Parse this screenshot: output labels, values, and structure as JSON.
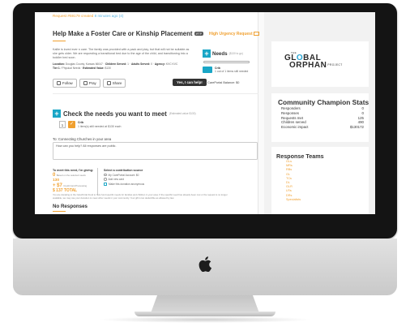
{
  "request": {
    "header": "Request #59179 created",
    "since": "8 minutes ago (4)",
    "title": "Help Make a Foster Care or Kinship Placement",
    "title_tag": "IFTP",
    "urgency": "High Urgency Request",
    "description": "Kallie is loved ever n care. The family was provided with a pack and play, but that will not be suitable as she gets older. We are requesting a transitional bed due to the age of the child, and transitioning into a toddler bed soon.",
    "meta": {
      "location_label": "Location:",
      "location": "Douglas County, Kansas 66047",
      "children_label": "Children Served:",
      "children": "1",
      "adults_label": "Adults Served:",
      "adults": "0",
      "agency_label": "Agency:",
      "agency": "KVC KVC",
      "tier_label": "Tier 1",
      "type": "Physical Needs",
      "est_label": "Estimated Value:",
      "est_value": "$130"
    },
    "buttons": {
      "follow": "Follow",
      "pray": "Pray",
      "share": "Share",
      "help": "Yes, I can help!"
    }
  },
  "needs": {
    "label": "Needs",
    "sub": "($130 to go)",
    "item_name": "Crib",
    "item_status": "1 out of 1 items still needed",
    "balance_label": "My CarePortal Balance:",
    "balance": "$0",
    "progress": 0
  },
  "check": {
    "label": "Check the needs you want to meet",
    "sub": "(Estimated value $130)",
    "qty": "1",
    "item_name": "Crib",
    "item_detail": "1 item(s) still needed at $130 each"
  },
  "churches": {
    "label": "To: Connecting Churches in your area",
    "placeholder": "How can you help? All responses are public."
  },
  "funding": {
    "meet_label": "To meet this need, I'm giving:",
    "amount1": "0",
    "amount1_note": "Based on the selected needs",
    "amount2": "130",
    "amount3": "+ $7",
    "amount3_note": "Credit Card Processing",
    "total": "$ 137 TOTAL",
    "source_label": "Select a contribution source",
    "opt1": "My CarePortal Account: $0",
    "opt2": "Add new card",
    "opt3": "Make this donation anonymous"
  },
  "fine_print": "You are donating to the CarePortal Fund to help fund specific needs for families and children in your area. If the specific need has already been met or the request is no longer available, we may use your donation to meet other needs in your community. Your gift is tax deductible as allowed by law.",
  "responses": {
    "title": "No Responses"
  },
  "logo": {
    "the": "THE",
    "line1_a": "GL",
    "line1_o": "O",
    "line1_b": "BAL",
    "line2": "ORPHAN",
    "line2_suffix": "PROJECT"
  },
  "stats": {
    "title": "Community Champion Stats",
    "rows": [
      {
        "label": "Responders",
        "value": "0"
      },
      {
        "label": "Responses",
        "value": "0"
      },
      {
        "label": "Requests met",
        "value": "125"
      },
      {
        "label": "Children served",
        "value": "490"
      },
      {
        "label": "Economic impact",
        "value": "$130172"
      }
    ]
  },
  "teams": {
    "title": "Response Teams",
    "items": [
      "GLs",
      "MRs",
      "RBs",
      "GL",
      "TCs",
      "DL",
      "GLR",
      "LRs",
      "DRs",
      "Specialists"
    ]
  },
  "colors": {
    "accent": "#f0a030",
    "brand_blue": "#1aa6c6",
    "bezel": "#141414"
  }
}
